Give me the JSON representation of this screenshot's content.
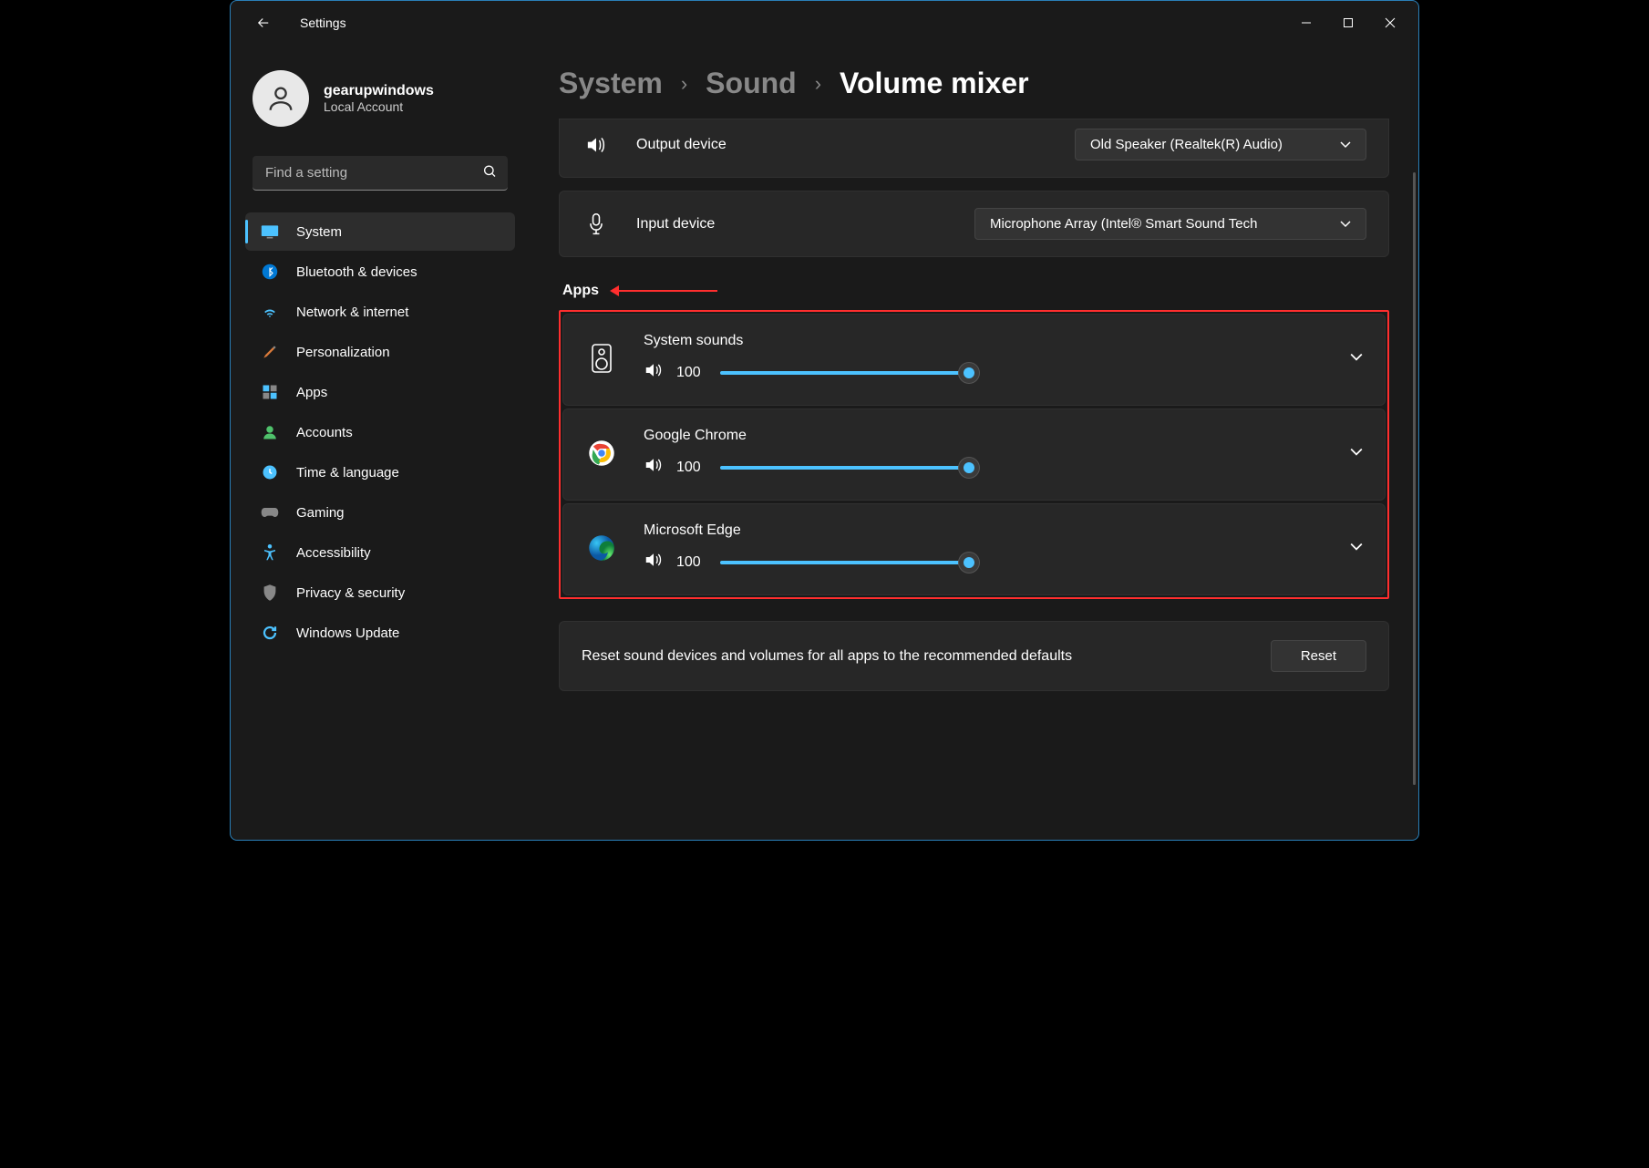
{
  "window": {
    "title": "Settings"
  },
  "profile": {
    "name": "gearupwindows",
    "subtitle": "Local Account"
  },
  "search": {
    "placeholder": "Find a setting"
  },
  "nav": [
    {
      "id": "system",
      "label": "System",
      "active": true
    },
    {
      "id": "bluetooth",
      "label": "Bluetooth & devices"
    },
    {
      "id": "network",
      "label": "Network & internet"
    },
    {
      "id": "personalization",
      "label": "Personalization"
    },
    {
      "id": "apps",
      "label": "Apps"
    },
    {
      "id": "accounts",
      "label": "Accounts"
    },
    {
      "id": "time",
      "label": "Time & language"
    },
    {
      "id": "gaming",
      "label": "Gaming"
    },
    {
      "id": "accessibility",
      "label": "Accessibility"
    },
    {
      "id": "privacy",
      "label": "Privacy & security"
    },
    {
      "id": "update",
      "label": "Windows Update"
    }
  ],
  "breadcrumb": {
    "p0": "System",
    "p1": "Sound",
    "p2": "Volume mixer"
  },
  "devices": {
    "output": {
      "label": "Output device",
      "value": "Old Speaker (Realtek(R) Audio)"
    },
    "input": {
      "label": "Input device",
      "value": "Microphone Array (Intel® Smart Sound Tech"
    }
  },
  "apps_section": {
    "title": "Apps"
  },
  "apps": [
    {
      "name": "System sounds",
      "volume": "100"
    },
    {
      "name": "Google Chrome",
      "volume": "100"
    },
    {
      "name": "Microsoft Edge",
      "volume": "100"
    }
  ],
  "reset": {
    "text": "Reset sound devices and volumes for all apps to the recommended defaults",
    "button": "Reset"
  }
}
